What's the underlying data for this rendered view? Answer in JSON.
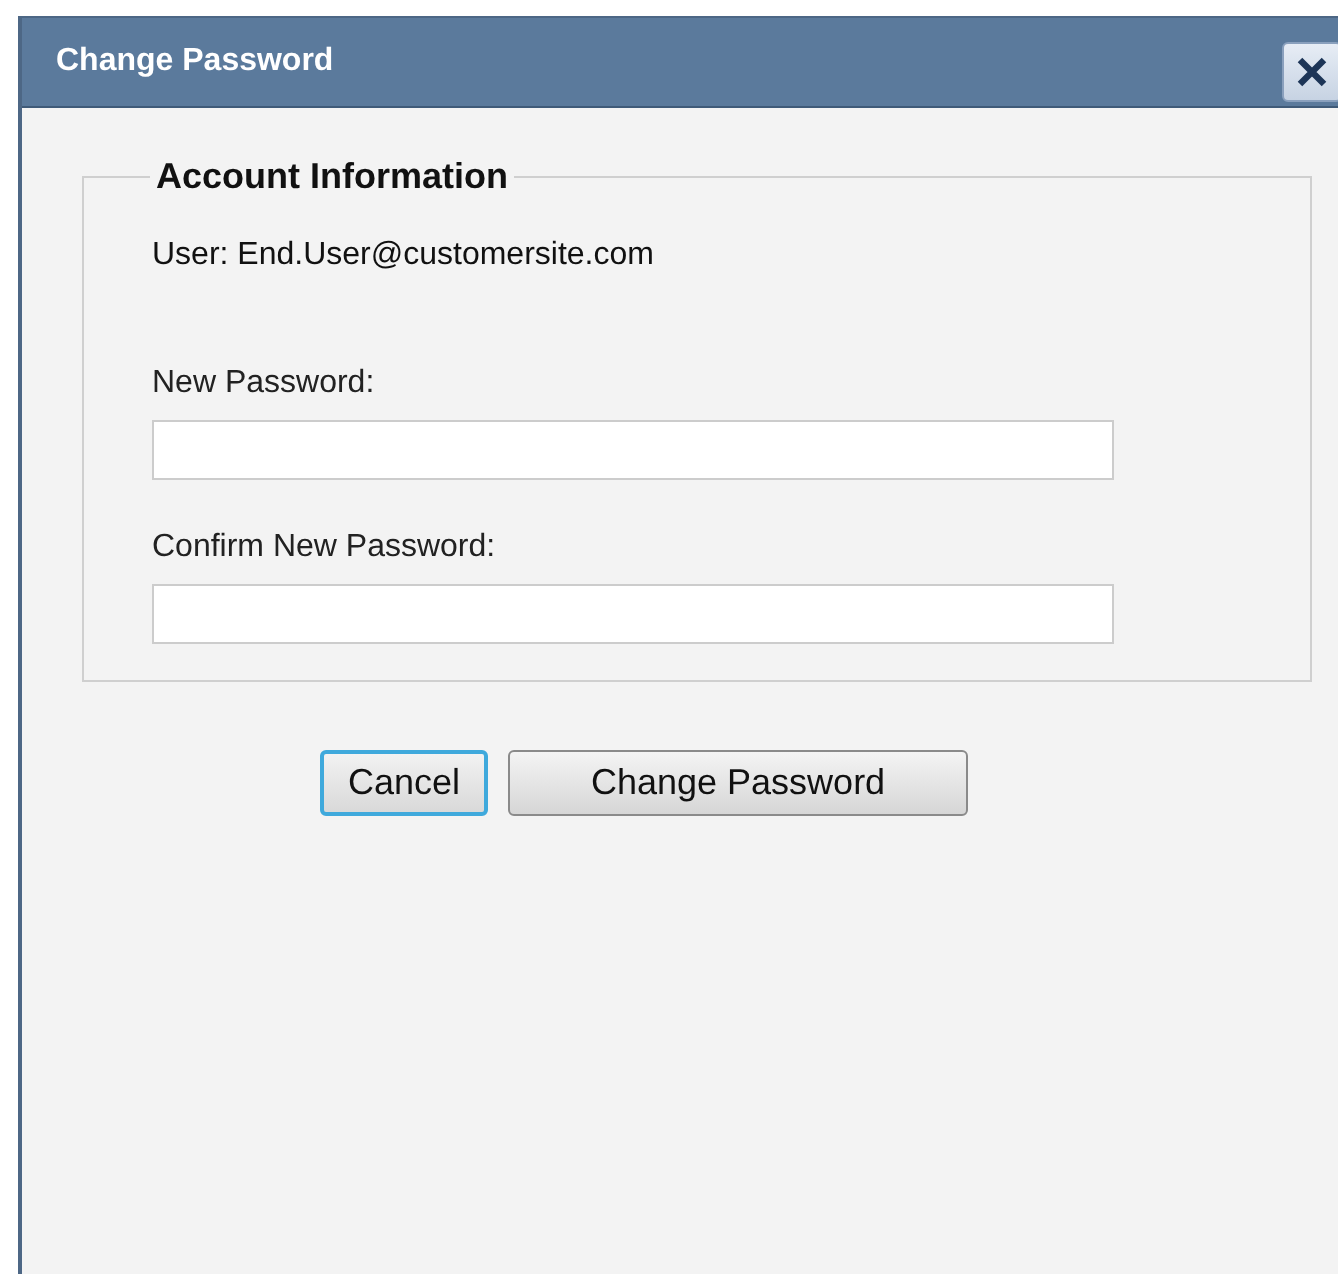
{
  "window": {
    "title": "Change Password"
  },
  "fieldset": {
    "legend": "Account Information",
    "user": "User: End.User@customersite.com",
    "fields": [
      {
        "label": "New Password:"
      },
      {
        "label": "Confirm New Password:"
      }
    ]
  },
  "buttons": [
    {
      "label": "Cancel",
      "focused": true
    },
    {
      "label": "Change Password",
      "focused": false
    }
  ]
}
